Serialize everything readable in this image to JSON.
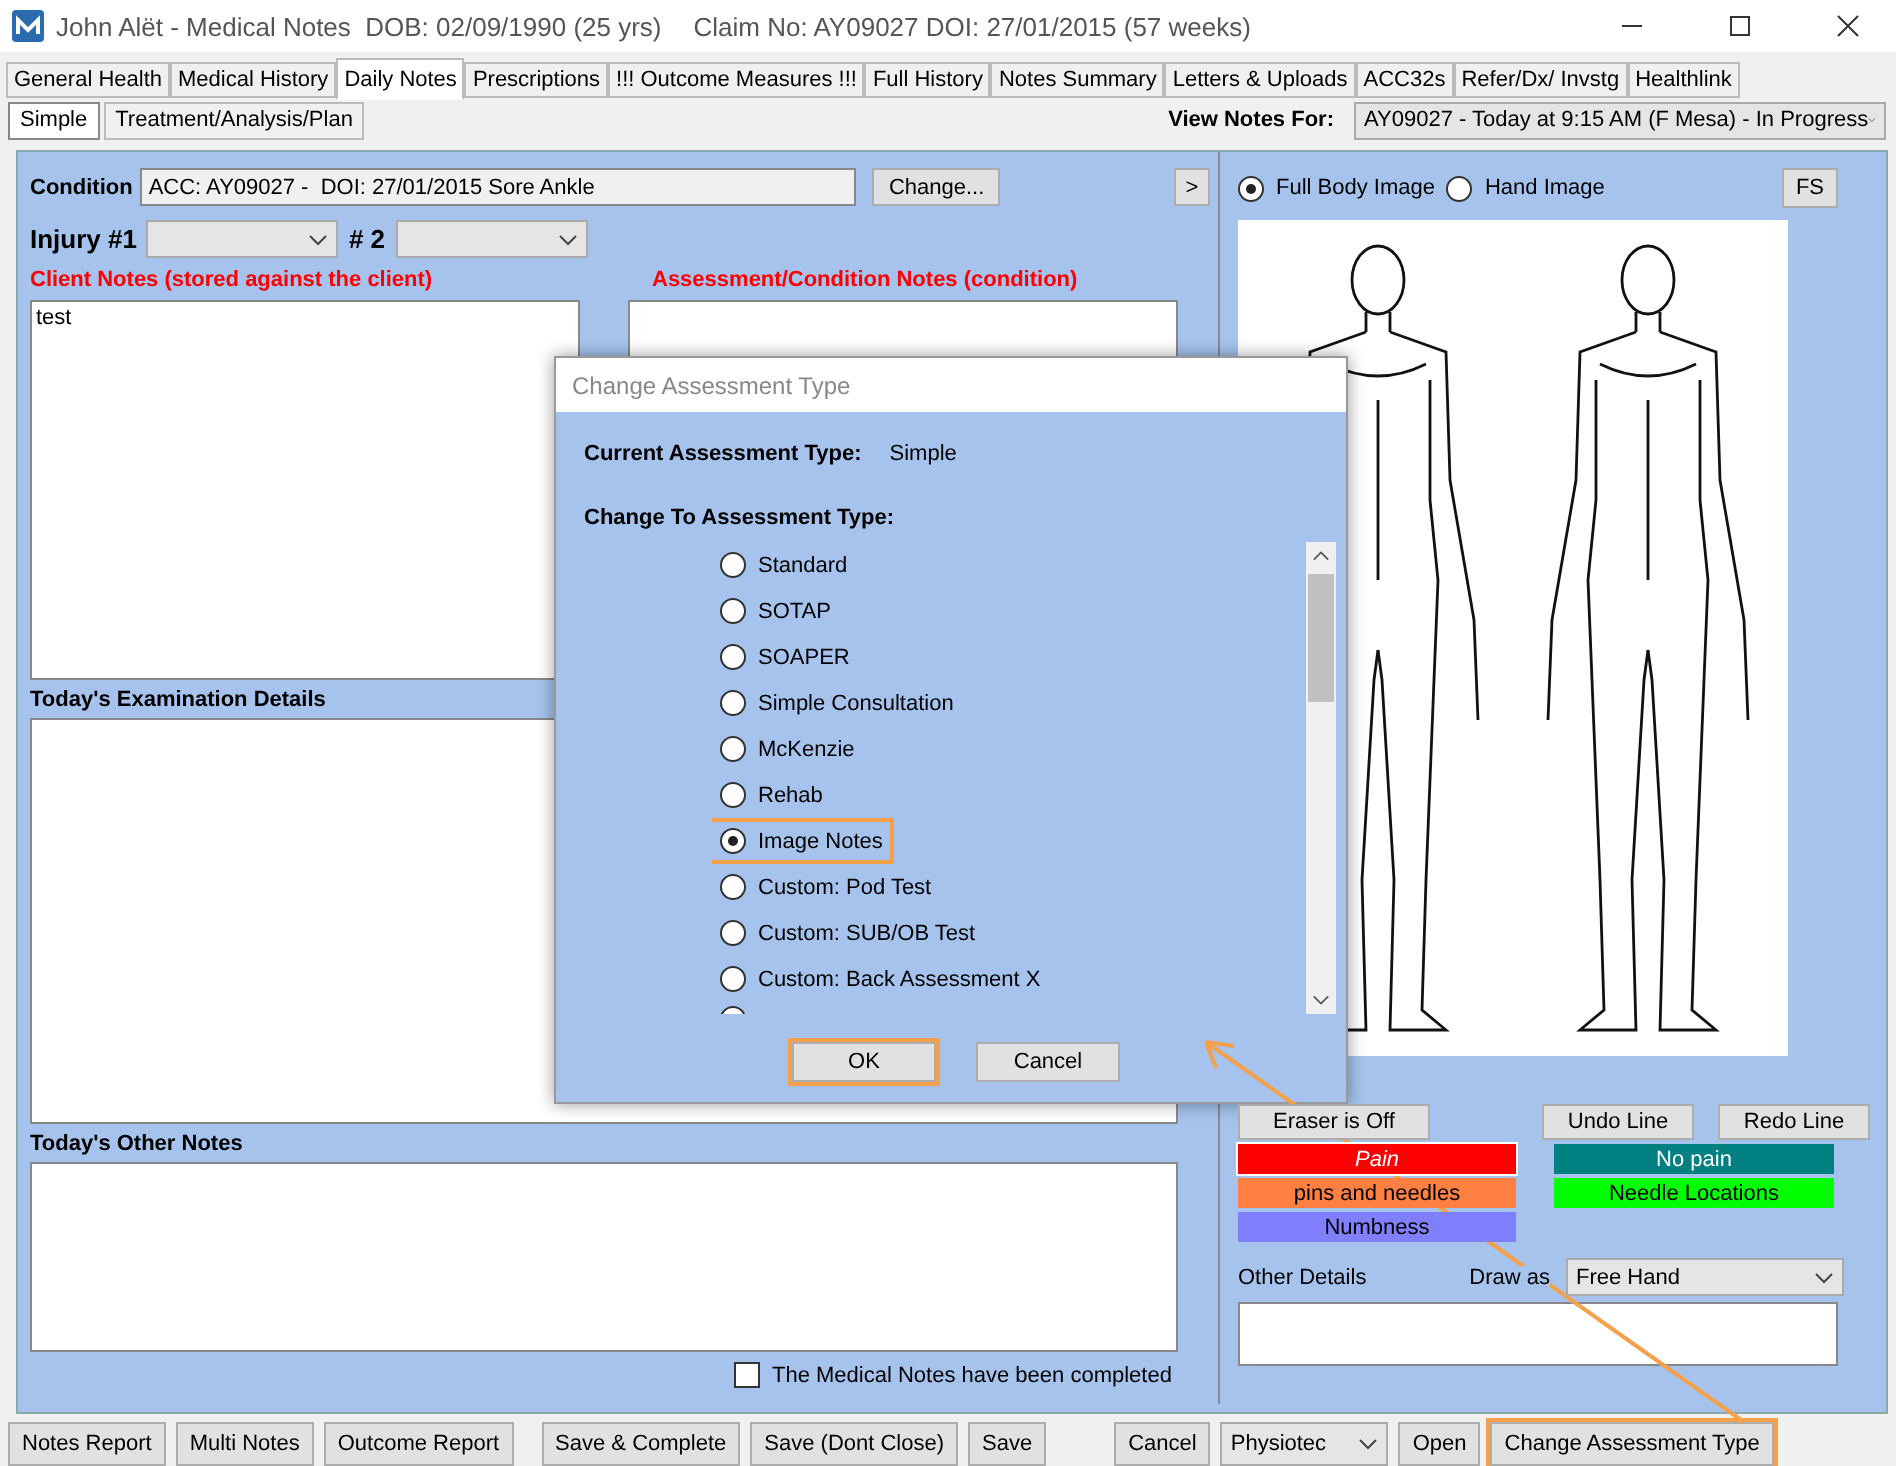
{
  "window": {
    "title": "John Alët - Medical Notes  DOB: 02/09/1990 (25 yrs)",
    "claim": "Claim No: AY09027 DOI: 27/01/2015 (57 weeks)"
  },
  "tabs": [
    {
      "label": "General Health",
      "selected": false
    },
    {
      "label": "Medical History",
      "selected": false
    },
    {
      "label": "Daily Notes",
      "selected": true
    },
    {
      "label": "Prescriptions",
      "selected": false
    },
    {
      "label": "!!! Outcome Measures !!!",
      "selected": false
    },
    {
      "label": "Full History",
      "selected": false
    },
    {
      "label": "Notes Summary",
      "selected": false
    },
    {
      "label": "Letters & Uploads",
      "selected": false
    },
    {
      "label": "ACC32s",
      "selected": false
    },
    {
      "label": "Refer/Dx/ Invstg",
      "selected": false
    },
    {
      "label": "Healthlink",
      "selected": false
    }
  ],
  "subtabs": [
    {
      "label": "Simple",
      "selected": true
    },
    {
      "label": "Treatment/Analysis/Plan",
      "selected": false
    }
  ],
  "view_notes": {
    "label": "View Notes For:",
    "value": "AY09027 - Today at 9:15 AM (F Mesa) - In Progress"
  },
  "condition": {
    "label": "Condition",
    "value": "ACC: AY09027 -  DOI: 27/01/2015 Sore Ankle",
    "button": "Change...",
    "expand_button": ">"
  },
  "injury": {
    "label_1": "Injury #1",
    "label_2": "# 2"
  },
  "client_notes": {
    "label": "Client Notes (stored against the client)",
    "value": "test"
  },
  "assessment_notes": {
    "label": "Assessment/Condition Notes (condition)"
  },
  "examination": {
    "label": "Today's Examination Details"
  },
  "other_notes": {
    "label": "Today's Other Notes"
  },
  "completed": {
    "label": "The Medical Notes have been completed",
    "checked": false
  },
  "image_panel": {
    "options": [
      {
        "label": "Full Body Image",
        "selected": true
      },
      {
        "label": "Hand Image",
        "selected": false
      }
    ],
    "fs_button": "FS",
    "tools": [
      "Eraser is Off",
      "Undo Line",
      "Redo Line"
    ],
    "legend": [
      {
        "label": "Pain",
        "color": "#ff0000",
        "selected": true
      },
      {
        "label": "No pain",
        "color": "#008080",
        "selected": false
      },
      {
        "label": "pins and needles",
        "color": "#ff8040",
        "selected": false
      },
      {
        "label": "Needle Locations",
        "color": "#00ff00",
        "selected": false
      },
      {
        "label": "Numbness",
        "color": "#8080ff",
        "selected": false
      }
    ],
    "other_details_label": "Other Details",
    "draw_as_label": "Draw as",
    "draw_as_value": "Free Hand"
  },
  "button_groups": [
    [
      {
        "label": "Notes Report",
        "kind": "button",
        "highlighted": false
      },
      {
        "label": "Multi Notes",
        "kind": "button",
        "highlighted": false
      },
      {
        "label": "Outcome Report",
        "kind": "button",
        "highlighted": false
      }
    ],
    [
      {
        "label": "Save & Complete",
        "kind": "button",
        "highlighted": false
      },
      {
        "label": "Save (Dont Close)",
        "kind": "button",
        "highlighted": false
      },
      {
        "label": "Save",
        "kind": "button",
        "highlighted": false
      }
    ],
    [
      {
        "label": "Cancel",
        "kind": "button",
        "highlighted": false
      },
      {
        "label": "Physiotec",
        "kind": "dropdown",
        "highlighted": false
      },
      {
        "label": "Open",
        "kind": "button",
        "highlighted": false
      },
      {
        "label": "Change Assessment Type",
        "kind": "button",
        "highlighted": true
      }
    ]
  ],
  "dialog": {
    "title": "Change Assessment Type",
    "current_label": "Current Assessment Type:",
    "current_value": "Simple",
    "change_label": "Change To Assessment Type:",
    "options": [
      {
        "label": "Standard",
        "selected": false,
        "highlighted": false
      },
      {
        "label": "SOTAP",
        "selected": false,
        "highlighted": false
      },
      {
        "label": "SOAPER",
        "selected": false,
        "highlighted": false
      },
      {
        "label": "Simple Consultation",
        "selected": false,
        "highlighted": false
      },
      {
        "label": "McKenzie",
        "selected": false,
        "highlighted": false
      },
      {
        "label": "Rehab",
        "selected": false,
        "highlighted": false
      },
      {
        "label": "Image Notes",
        "selected": true,
        "highlighted": true
      },
      {
        "label": "Custom: Pod Test",
        "selected": false,
        "highlighted": false
      },
      {
        "label": "Custom: SUB/OB Test",
        "selected": false,
        "highlighted": false
      },
      {
        "label": "Custom: Back Assessment X",
        "selected": false,
        "highlighted": false
      }
    ],
    "buttons": [
      {
        "label": "OK",
        "highlighted": true
      },
      {
        "label": "Cancel",
        "highlighted": false
      }
    ]
  }
}
